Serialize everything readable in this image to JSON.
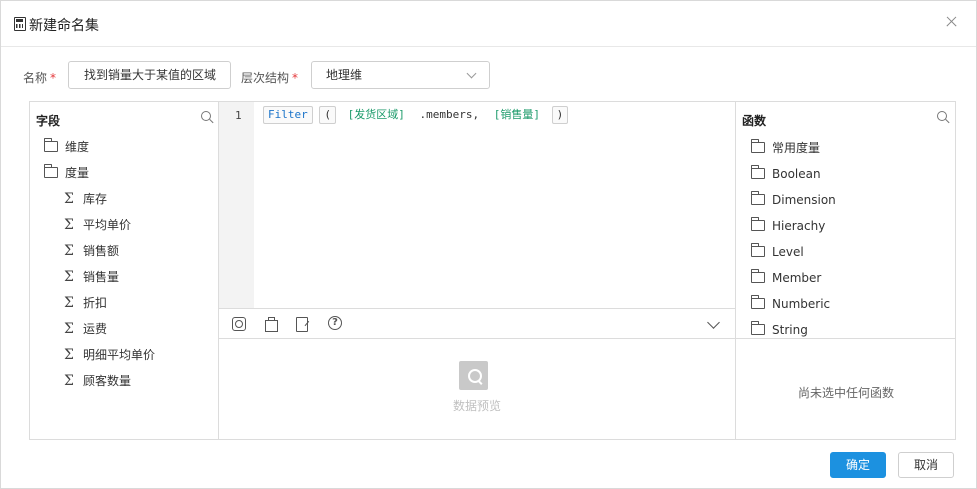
{
  "dialog": {
    "title": "新建命名集",
    "close_icon": "close-icon",
    "title_icon": "calculator-icon"
  },
  "form": {
    "name_label": "名称",
    "name_value": "找到销量大于某值的区域",
    "hierarchy_label": "层次结构",
    "hierarchy_value": "地理维",
    "required_mark": "*"
  },
  "fields_panel": {
    "title": "字段",
    "items": [
      {
        "label": "维度",
        "icon": "folder-icon"
      },
      {
        "label": "度量",
        "icon": "folder-open-icon"
      },
      {
        "label": "库存",
        "icon": "sigma-icon"
      },
      {
        "label": "平均单价",
        "icon": "sigma-icon"
      },
      {
        "label": "销售额",
        "icon": "sigma-icon"
      },
      {
        "label": "销售量",
        "icon": "sigma-icon"
      },
      {
        "label": "折扣",
        "icon": "sigma-icon"
      },
      {
        "label": "运费",
        "icon": "sigma-icon"
      },
      {
        "label": "明细平均单价",
        "icon": "sigma-icon"
      },
      {
        "label": "顾客数量",
        "icon": "sigma-icon"
      }
    ]
  },
  "editor": {
    "line_number": "1",
    "tokens": {
      "func": "Filter",
      "paren_open": "(",
      "dim": "[发货区域]",
      "member": ".members,",
      "measure": "[销售量]",
      "paren_close": ")"
    }
  },
  "preview": {
    "label": "数据预览"
  },
  "functions_panel": {
    "title": "函数",
    "items": [
      "常用度量",
      "Boolean",
      "Dimension",
      "Hierachy",
      "Level",
      "Member",
      "Numberic",
      "String"
    ],
    "empty_text": "尚未选中任何函数"
  },
  "buttons": {
    "ok": "确定",
    "cancel": "取消"
  },
  "colors": {
    "primary": "#1c91e0",
    "keyword": "#1a73c9",
    "dimension_token": "#1b9a6a",
    "required": "#e4393c"
  }
}
